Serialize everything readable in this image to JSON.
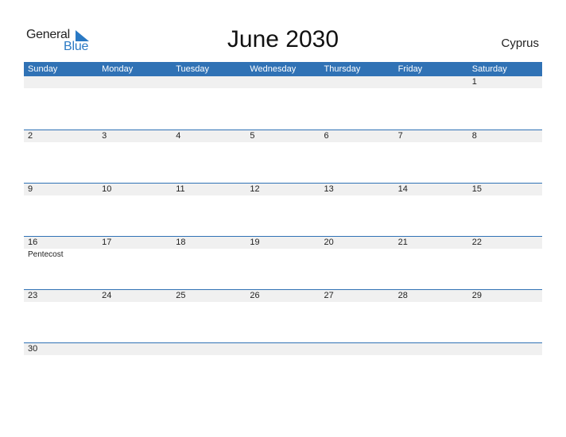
{
  "logo": {
    "line1": "General",
    "line2": "Blue",
    "accent_color": "#2a79c4"
  },
  "title": "June 2030",
  "country": "Cyprus",
  "colors": {
    "header_bg": "#3072b5",
    "date_band_bg": "#f0f0f0"
  },
  "weekdays": [
    "Sunday",
    "Monday",
    "Tuesday",
    "Wednesday",
    "Thursday",
    "Friday",
    "Saturday"
  ],
  "weeks": [
    [
      "",
      "",
      "",
      "",
      "",
      "",
      "1"
    ],
    [
      "2",
      "3",
      "4",
      "5",
      "6",
      "7",
      "8"
    ],
    [
      "9",
      "10",
      "11",
      "12",
      "13",
      "14",
      "15"
    ],
    [
      "16",
      "17",
      "18",
      "19",
      "20",
      "21",
      "22"
    ],
    [
      "23",
      "24",
      "25",
      "26",
      "27",
      "28",
      "29"
    ],
    [
      "30",
      "",
      "",
      "",
      "",
      "",
      ""
    ]
  ],
  "events": {
    "16": "Pentecost"
  }
}
